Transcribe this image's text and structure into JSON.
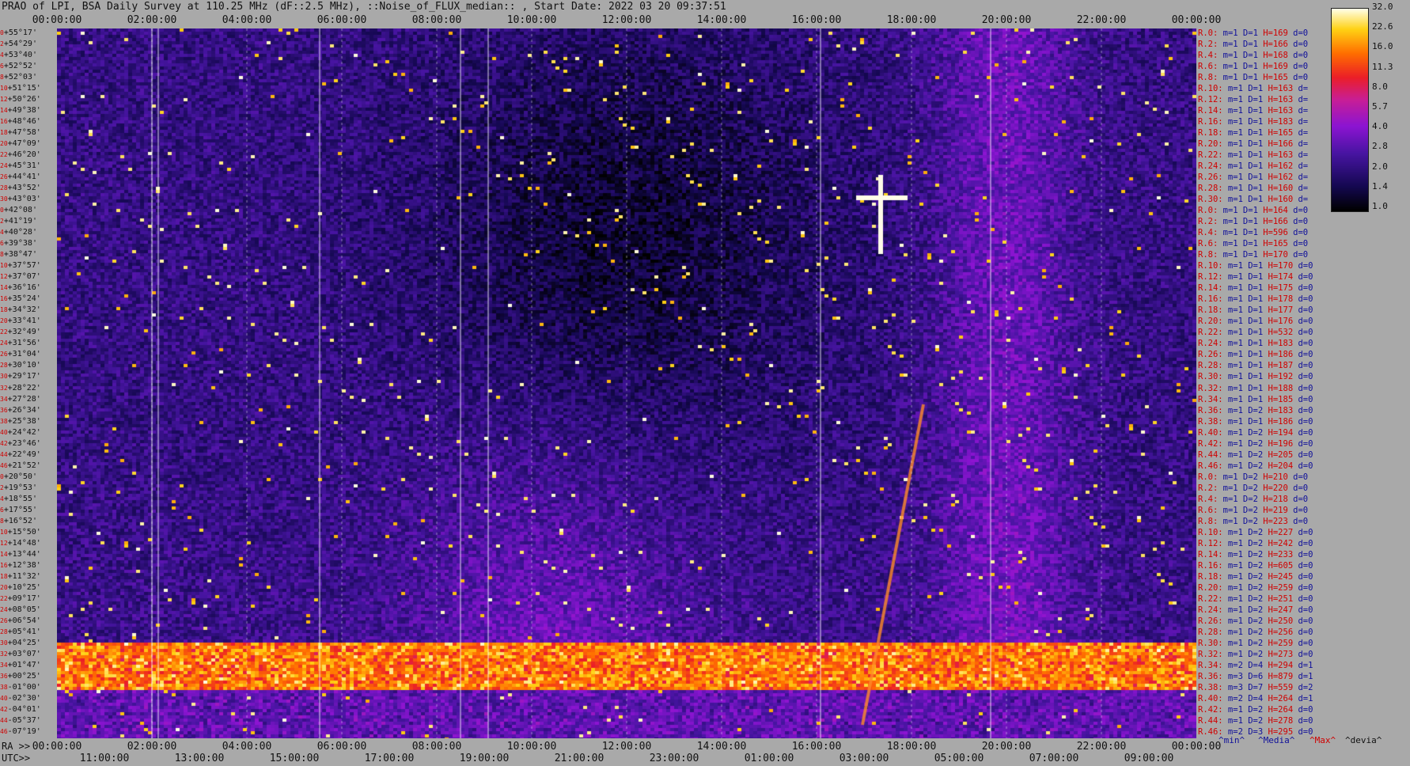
{
  "header": {
    "title": "PRAO of LPI, BSA Daily Survey at 110.25 MHz (dF::2.5 MHz), ::Noise_of_FLUX_median:: , Start Date: 2022 03 20 09:37:51"
  },
  "chart_data": {
    "type": "heatmap",
    "title": "PRAO of LPI, BSA Daily Survey at 110.25 MHz (dF::2.5 MHz), ::Noise_of_FLUX_median:: , Start Date: 2022 03 20 09:37:51",
    "xlabel_top": "",
    "xlabel_bottom_ra": "RA >>",
    "xlabel_bottom_utc": "UTC>>",
    "x_ticks_top": [
      "00:00:00",
      "02:00:00",
      "04:00:00",
      "06:00:00",
      "08:00:00",
      "10:00:00",
      "12:00:00",
      "14:00:00",
      "16:00:00",
      "18:00:00",
      "20:00:00",
      "22:00:00",
      "00:00:00"
    ],
    "x_ticks_bottom_ra": [
      "00:00:00",
      "02:00:00",
      "04:00:00",
      "06:00:00",
      "08:00:00",
      "10:00:00",
      "12:00:00",
      "14:00:00",
      "16:00:00",
      "18:00:00",
      "20:00:00",
      "22:00:00",
      "00:00:00"
    ],
    "x_ticks_bottom_utc": [
      "11:00:00",
      "13:00:00",
      "15:00:00",
      "17:00:00",
      "19:00:00",
      "21:00:00",
      "23:00:00",
      "01:00:00",
      "03:00:00",
      "05:00:00",
      "07:00:00",
      "09:00:00"
    ],
    "y_ticks": [
      "+55°17'",
      "+54°29'",
      "+53°40'",
      "+52°52'",
      "+52°03'",
      "+51°15'",
      "+50°26'",
      "+49°38'",
      "+48°46'",
      "+47°58'",
      "+47°09'",
      "+46°20'",
      "+45°31'",
      "+44°41'",
      "+43°52'",
      "+43°03'",
      "+42°08'",
      "+41°19'",
      "+40°28'",
      "+39°38'",
      "+38°47'",
      "+37°57'",
      "+37°07'",
      "+36°16'",
      "+35°24'",
      "+34°32'",
      "+33°41'",
      "+32°49'",
      "+31°56'",
      "+31°04'",
      "+30°10'",
      "+29°17'",
      "+28°22'",
      "+27°28'",
      "+26°34'",
      "+25°38'",
      "+24°42'",
      "+23°46'",
      "+22°49'",
      "+21°52'",
      "+20°50'",
      "+19°53'",
      "+18°55'",
      "+17°55'",
      "+16°52'",
      "+15°50'",
      "+14°48'",
      "+13°44'",
      "+12°38'",
      "+11°32'",
      "+10°25'",
      "+09°17'",
      "+08°05'",
      "+06°54'",
      "+05°41'",
      "+04°25'",
      "+03°07'",
      "+01°47'",
      "+00°25'",
      "-01°00'",
      "-02°30'",
      "-04°01'",
      "-05°37'",
      "-07°19'"
    ],
    "y_index": [
      "0",
      "2",
      "4",
      "6",
      "8",
      "10",
      "12",
      "14",
      "16",
      "18",
      "20",
      "22",
      "24",
      "26",
      "28",
      "30",
      "0",
      "2",
      "4",
      "6",
      "8",
      "10",
      "12",
      "14",
      "16",
      "18",
      "20",
      "22",
      "24",
      "26",
      "28",
      "30",
      "32",
      "34",
      "36",
      "38",
      "40",
      "42",
      "44",
      "46",
      "0",
      "2",
      "4",
      "6",
      "8",
      "10",
      "12",
      "14",
      "16",
      "18",
      "20",
      "22",
      "24",
      "26",
      "28",
      "30",
      "32",
      "34",
      "36",
      "38",
      "40",
      "42",
      "44",
      "46"
    ],
    "colorbar": {
      "ticks": [
        "32.0",
        "22.6",
        "16.0",
        "11.3",
        "8.0",
        "5.7",
        "4.0",
        "2.8",
        "2.0",
        "1.4",
        "1.0"
      ],
      "min": 1.0,
      "max": 32.0,
      "scale": "log"
    },
    "row_stats": [
      {
        "r": "R.0:",
        "m": "1",
        "D": "1",
        "H": "169",
        "d": "0"
      },
      {
        "r": "R.2:",
        "m": "1",
        "D": "1",
        "H": "166",
        "d": "0"
      },
      {
        "r": "R.4:",
        "m": "1",
        "D": "1",
        "H": "168",
        "d": "0"
      },
      {
        "r": "R.6:",
        "m": "1",
        "D": "1",
        "H": "169",
        "d": "0"
      },
      {
        "r": "R.8:",
        "m": "1",
        "D": "1",
        "H": "165",
        "d": "0"
      },
      {
        "r": "R.10:",
        "m": "1",
        "D": "1",
        "H": "163",
        "d": ""
      },
      {
        "r": "R.12:",
        "m": "1",
        "D": "1",
        "H": "163",
        "d": ""
      },
      {
        "r": "R.14:",
        "m": "1",
        "D": "1",
        "H": "163",
        "d": ""
      },
      {
        "r": "R.16:",
        "m": "1",
        "D": "1",
        "H": "183",
        "d": ""
      },
      {
        "r": "R.18:",
        "m": "1",
        "D": "1",
        "H": "165",
        "d": ""
      },
      {
        "r": "R.20:",
        "m": "1",
        "D": "1",
        "H": "166",
        "d": ""
      },
      {
        "r": "R.22:",
        "m": "1",
        "D": "1",
        "H": "163",
        "d": ""
      },
      {
        "r": "R.24:",
        "m": "1",
        "D": "1",
        "H": "162",
        "d": ""
      },
      {
        "r": "R.26:",
        "m": "1",
        "D": "1",
        "H": "162",
        "d": ""
      },
      {
        "r": "R.28:",
        "m": "1",
        "D": "1",
        "H": "160",
        "d": ""
      },
      {
        "r": "R.30:",
        "m": "1",
        "D": "1",
        "H": "160",
        "d": ""
      },
      {
        "r": "R.0:",
        "m": "1",
        "D": "1",
        "H": "164",
        "d": "0"
      },
      {
        "r": "R.2:",
        "m": "1",
        "D": "1",
        "H": "166",
        "d": "0"
      },
      {
        "r": "R.4:",
        "m": "1",
        "D": "1",
        "H": "596",
        "d": "0"
      },
      {
        "r": "R.6:",
        "m": "1",
        "D": "1",
        "H": "165",
        "d": "0"
      },
      {
        "r": "R.8:",
        "m": "1",
        "D": "1",
        "H": "170",
        "d": "0"
      },
      {
        "r": "R.10:",
        "m": "1",
        "D": "1",
        "H": "170",
        "d": "0"
      },
      {
        "r": "R.12:",
        "m": "1",
        "D": "1",
        "H": "174",
        "d": "0"
      },
      {
        "r": "R.14:",
        "m": "1",
        "D": "1",
        "H": "175",
        "d": "0"
      },
      {
        "r": "R.16:",
        "m": "1",
        "D": "1",
        "H": "178",
        "d": "0"
      },
      {
        "r": "R.18:",
        "m": "1",
        "D": "1",
        "H": "177",
        "d": "0"
      },
      {
        "r": "R.20:",
        "m": "1",
        "D": "1",
        "H": "176",
        "d": "0"
      },
      {
        "r": "R.22:",
        "m": "1",
        "D": "1",
        "H": "532",
        "d": "0"
      },
      {
        "r": "R.24:",
        "m": "1",
        "D": "1",
        "H": "183",
        "d": "0"
      },
      {
        "r": "R.26:",
        "m": "1",
        "D": "1",
        "H": "186",
        "d": "0"
      },
      {
        "r": "R.28:",
        "m": "1",
        "D": "1",
        "H": "187",
        "d": "0"
      },
      {
        "r": "R.30:",
        "m": "1",
        "D": "1",
        "H": "192",
        "d": "0"
      },
      {
        "r": "R.32:",
        "m": "1",
        "D": "1",
        "H": "188",
        "d": "0"
      },
      {
        "r": "R.34:",
        "m": "1",
        "D": "1",
        "H": "185",
        "d": "0"
      },
      {
        "r": "R.36:",
        "m": "1",
        "D": "2",
        "H": "183",
        "d": "0"
      },
      {
        "r": "R.38:",
        "m": "1",
        "D": "1",
        "H": "186",
        "d": "0"
      },
      {
        "r": "R.40:",
        "m": "1",
        "D": "2",
        "H": "194",
        "d": "0"
      },
      {
        "r": "R.42:",
        "m": "1",
        "D": "2",
        "H": "196",
        "d": "0"
      },
      {
        "r": "R.44:",
        "m": "1",
        "D": "2",
        "H": "205",
        "d": "0"
      },
      {
        "r": "R.46:",
        "m": "1",
        "D": "2",
        "H": "204",
        "d": "0"
      },
      {
        "r": "R.0:",
        "m": "1",
        "D": "2",
        "H": "210",
        "d": "0"
      },
      {
        "r": "R.2:",
        "m": "1",
        "D": "2",
        "H": "220",
        "d": "0"
      },
      {
        "r": "R.4:",
        "m": "1",
        "D": "2",
        "H": "218",
        "d": "0"
      },
      {
        "r": "R.6:",
        "m": "1",
        "D": "2",
        "H": "219",
        "d": "0"
      },
      {
        "r": "R.8:",
        "m": "1",
        "D": "2",
        "H": "223",
        "d": "0"
      },
      {
        "r": "R.10:",
        "m": "1",
        "D": "2",
        "H": "227",
        "d": "0"
      },
      {
        "r": "R.12:",
        "m": "1",
        "D": "2",
        "H": "242",
        "d": "0"
      },
      {
        "r": "R.14:",
        "m": "1",
        "D": "2",
        "H": "233",
        "d": "0"
      },
      {
        "r": "R.16:",
        "m": "1",
        "D": "2",
        "H": "605",
        "d": "0"
      },
      {
        "r": "R.18:",
        "m": "1",
        "D": "2",
        "H": "245",
        "d": "0"
      },
      {
        "r": "R.20:",
        "m": "1",
        "D": "2",
        "H": "259",
        "d": "0"
      },
      {
        "r": "R.22:",
        "m": "1",
        "D": "2",
        "H": "251",
        "d": "0"
      },
      {
        "r": "R.24:",
        "m": "1",
        "D": "2",
        "H": "247",
        "d": "0"
      },
      {
        "r": "R.26:",
        "m": "1",
        "D": "2",
        "H": "250",
        "d": "0"
      },
      {
        "r": "R.28:",
        "m": "1",
        "D": "2",
        "H": "256",
        "d": "0"
      },
      {
        "r": "R.30:",
        "m": "1",
        "D": "2",
        "H": "259",
        "d": "0"
      },
      {
        "r": "R.32:",
        "m": "1",
        "D": "2",
        "H": "273",
        "d": "0"
      },
      {
        "r": "R.34:",
        "m": "2",
        "D": "4",
        "H": "294",
        "d": "1"
      },
      {
        "r": "R.36:",
        "m": "3",
        "D": "6",
        "H": "879",
        "d": "1"
      },
      {
        "r": "R.38:",
        "m": "3",
        "D": "7",
        "H": "559",
        "d": "2"
      },
      {
        "r": "R.40:",
        "m": "2",
        "D": "4",
        "H": "264",
        "d": "1"
      },
      {
        "r": "R.42:",
        "m": "1",
        "D": "2",
        "H": "264",
        "d": "0"
      },
      {
        "r": "R.44:",
        "m": "1",
        "D": "2",
        "H": "278",
        "d": "0"
      },
      {
        "r": "R.46:",
        "m": "2",
        "D": "3",
        "H": "295",
        "d": "0"
      }
    ],
    "legend": [
      "^min^",
      "^Media^",
      "^Max^",
      "^devia^"
    ]
  },
  "colors": {
    "background": "#a9a9a9",
    "legend_blue": "#10109a",
    "legend_red": "#d00000"
  }
}
